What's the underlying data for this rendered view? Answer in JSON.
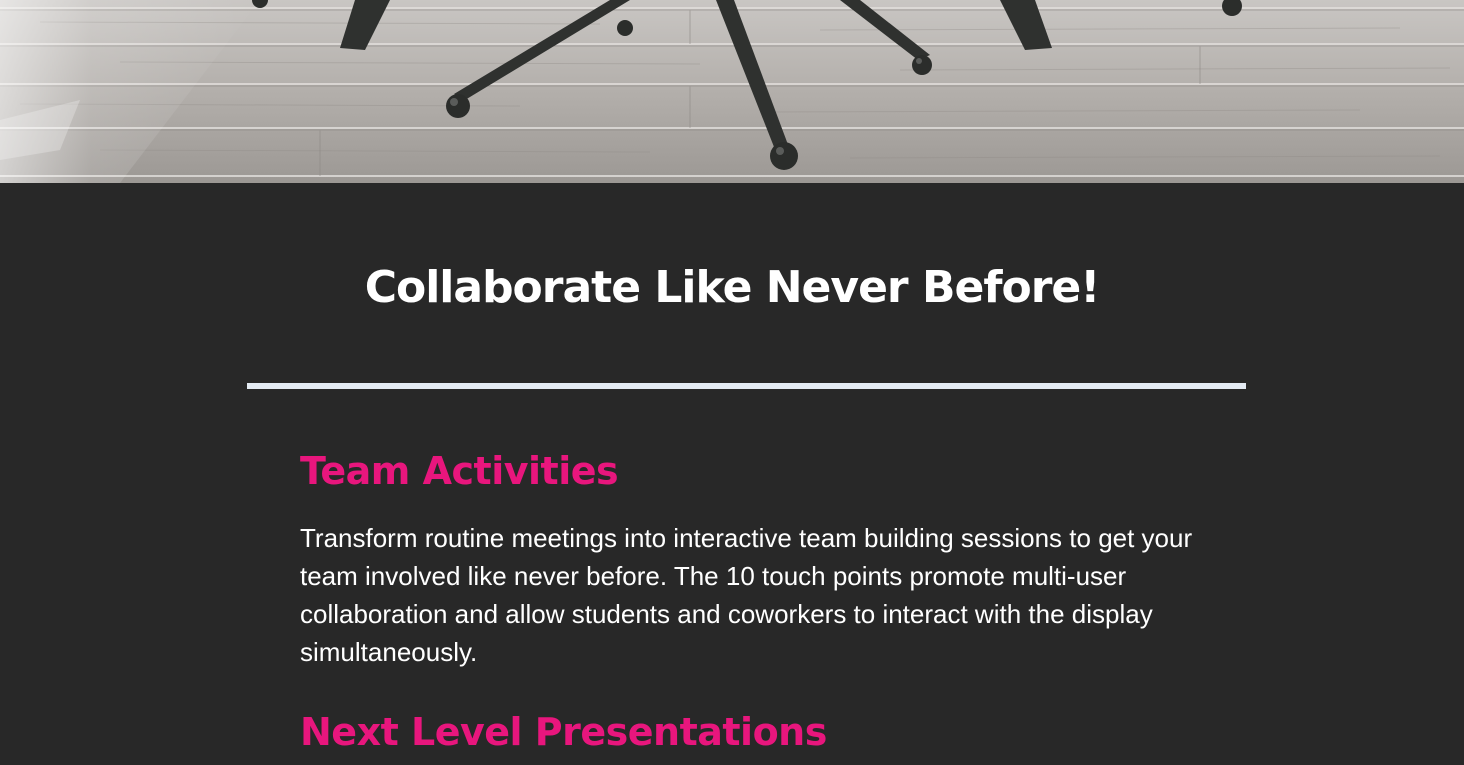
{
  "hero": {
    "image": "office-chair-on-wooden-floor"
  },
  "main": {
    "title": "Collaborate Like Never Before!",
    "sections": [
      {
        "heading": "Team Activities",
        "body": "Transform routine meetings into interactive team building sessions to get your team involved like never before. The 10 touch points promote multi-user collaboration and allow students and coworkers to interact with the display simultaneously."
      },
      {
        "heading": "Next Level Presentations"
      }
    ]
  },
  "colors": {
    "background": "#282828",
    "accent": "#e8167d",
    "divider": "#e4ebf3",
    "text": "#ffffff"
  }
}
